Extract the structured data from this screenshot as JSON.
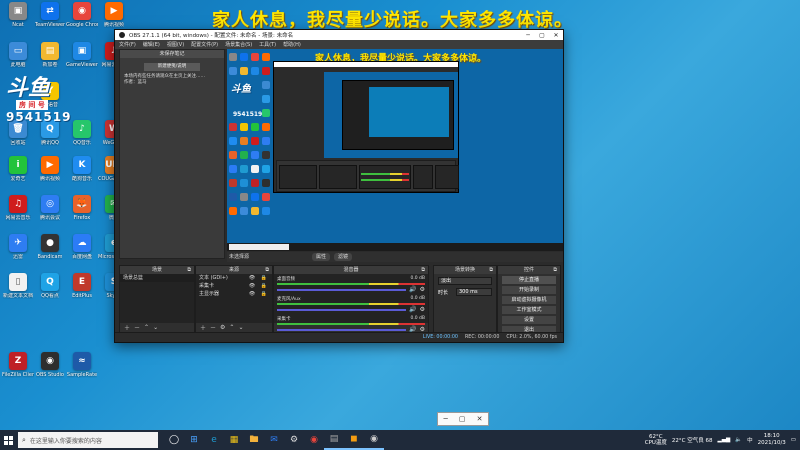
{
  "banner": "家人休息，我尽量少说话。大家多多体谅。",
  "desktop": {
    "icons": [
      {
        "label": "Ncat",
        "color": "#888888",
        "glyph": "▣"
      },
      {
        "label": "TeamViewer",
        "color": "#0e72ed",
        "glyph": "⇄"
      },
      {
        "label": "Google Chrome",
        "color": "#e8453c",
        "glyph": "◉"
      },
      {
        "label": "腾讯视频",
        "color": "#ff6a00",
        "glyph": "▶"
      },
      {
        "label": "此电脑",
        "color": "#3c8bd9",
        "glyph": "▭"
      },
      {
        "label": "新加卷",
        "color": "#f2b830",
        "glyph": "▤"
      },
      {
        "label": "GameViewer",
        "color": "#1e88e5",
        "glyph": "▣"
      },
      {
        "label": "网易云音乐",
        "color": "#cf1d1d",
        "glyph": "♫"
      },
      {
        "label": "回收站",
        "color": "#3b8ad2",
        "glyph": "🗑"
      },
      {
        "label": "腾讯QQ",
        "color": "#2a9ae6",
        "glyph": "Q"
      },
      {
        "label": "QQ音乐",
        "color": "#26c66b",
        "glyph": "♪"
      },
      {
        "label": "WeGame",
        "color": "#cc3333",
        "glyph": "W"
      },
      {
        "label": "YY语音",
        "color": "#f5c500",
        "glyph": "Y"
      },
      {
        "label": "爱奇艺",
        "color": "#23c33b",
        "glyph": "i"
      },
      {
        "label": "腾讯视频",
        "color": "#ff6a00",
        "glyph": "▶"
      },
      {
        "label": "酷狗音乐",
        "color": "#1f8cf0",
        "glyph": "K"
      },
      {
        "label": "COUGAR UIX SYSTEM",
        "color": "#e67e22",
        "glyph": "UIX"
      },
      {
        "label": "网易云音乐",
        "color": "#cf1d1d",
        "glyph": "♫"
      },
      {
        "label": "腾讯会议",
        "color": "#2e7df2",
        "glyph": "◎"
      },
      {
        "label": "Firefox",
        "color": "#e8622a",
        "glyph": "🦊"
      },
      {
        "label": "微信",
        "color": "#22b14c",
        "glyph": "✉"
      },
      {
        "label": "迅雷",
        "color": "#2e7df2",
        "glyph": "✈"
      },
      {
        "label": "Bandicam",
        "color": "#333333",
        "glyph": "●"
      },
      {
        "label": "百度网盘",
        "color": "#2b7cf6",
        "glyph": "☁"
      },
      {
        "label": "Microsoft Edge",
        "color": "#1f9bd1",
        "glyph": "e"
      },
      {
        "label": "新建文本文档",
        "color": "#f1f1f1",
        "glyph": "▯"
      },
      {
        "label": "QQ看点",
        "color": "#1fa3e6",
        "glyph": "Q"
      },
      {
        "label": "EditPlus",
        "color": "#c0392b",
        "glyph": "E"
      },
      {
        "label": "Skype",
        "color": "#1e8fd6",
        "glyph": "S"
      },
      {
        "label": "FileZilla Client",
        "color": "#bf2026",
        "glyph": "Z"
      },
      {
        "label": "OBS Studio",
        "color": "#2e2e2e",
        "glyph": "◉"
      },
      {
        "label": "SampleRate",
        "color": "#1e5aa8",
        "glyph": "≈"
      }
    ],
    "promo": {
      "logo": "斗鱼",
      "room": "房 间 号",
      "number": "9541519"
    }
  },
  "obs": {
    "title": "OBS 27.1.1 (64 bit, windows) - 配置文件: 未命名 - 场景: 未命名",
    "menu": [
      "文件(F)",
      "编辑(E)",
      "视图(V)",
      "配置文件(P)",
      "场景集合(S)",
      "工具(T)",
      "帮助(H)"
    ],
    "notes": {
      "header": "未保存笔记",
      "button": "新建便笺/说明",
      "text": "本场内有些任务请观众在主页上关注……\n作者：蓝马"
    },
    "scene_label": "未选择源",
    "transition_buttons": [
      "属性",
      "滤镜"
    ],
    "docks": {
      "scenes": {
        "title": "场景",
        "items": [
          "场景总篮"
        ]
      },
      "sources": {
        "title": "来源",
        "items": [
          {
            "name": "文本 (GDI+)",
            "vis": "👁 🔒"
          },
          {
            "name": "采集卡",
            "vis": "👁 🔒"
          },
          {
            "name": "主显示器",
            "vis": "👁 🔒"
          }
        ]
      },
      "mixer": {
        "title": "混音器",
        "channels": [
          {
            "name": "桌面音频",
            "db": "0.0 dB"
          },
          {
            "name": "麦克风/Aux",
            "db": "0.0 dB"
          },
          {
            "name": "采集卡",
            "db": "0.0 dB"
          }
        ]
      },
      "transitions": {
        "title": "场景转换",
        "type": "淡出",
        "duration_label": "时长",
        "duration": "300 ms"
      },
      "controls": {
        "title": "控件",
        "buttons": [
          "停止直播",
          "开始录制",
          "启动虚拟摄像机",
          "工作室模式",
          "设置",
          "退出"
        ]
      }
    },
    "status": {
      "live": "LIVE: 00:00:00",
      "rec": "REC: 00:00:00",
      "cpu": "CPU: 2.0%, 60.00 fps"
    }
  },
  "taskbar": {
    "search_placeholder": "在这里输入你要搜索的内容",
    "apps": [
      "◯",
      "⊞",
      "e",
      "▦",
      "🖿",
      "✉",
      "⚙",
      "◉",
      "▤",
      "◼",
      "◉"
    ],
    "weather_temp": "62°C",
    "weather_label": "CPU温度",
    "tray_text": "22°C 空气良 68",
    "time": "18:10",
    "date": "2021/10/3"
  }
}
